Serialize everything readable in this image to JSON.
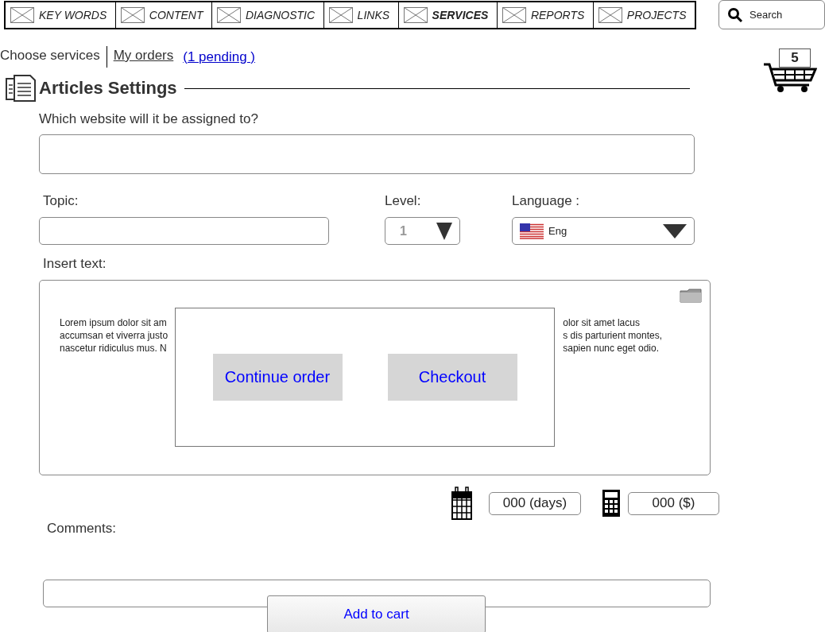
{
  "nav": {
    "tabs": [
      {
        "label": "KEY WORDS",
        "selected": false
      },
      {
        "label": "CONTENT",
        "selected": false
      },
      {
        "label": "DIAGNOSTIC",
        "selected": false
      },
      {
        "label": "LINKS",
        "selected": false
      },
      {
        "label": "SERVICES",
        "selected": true
      },
      {
        "label": "REPORTS",
        "selected": false
      },
      {
        "label": "PROJECTS",
        "selected": false
      }
    ],
    "search": {
      "placeholder": "Search"
    }
  },
  "subnav": {
    "items": [
      {
        "label": "Choose services",
        "selected": true
      },
      {
        "label": "My orders",
        "selected": false
      }
    ],
    "pending": "(1 pending )"
  },
  "cart": {
    "count": "5"
  },
  "section": {
    "title": "Articles Settings"
  },
  "form": {
    "website_label": "Which website will it be assigned to?",
    "topic_label": "Topic:",
    "level_label": "Level:",
    "level_value": "1",
    "language_label": "Language :",
    "language_value": "Eng",
    "text_label": "Insert text:",
    "text_left": [
      "Lorem ipsum dolor sit am",
      "accumsan et viverra justo",
      "nascetur ridiculus mus. N"
    ],
    "text_right": [
      "olor sit amet lacus",
      "s dis parturient montes,",
      "sapien nunc eget odio."
    ],
    "days": "000 (days)",
    "price": "000 ($)",
    "comments_label": "Comments:",
    "add_button": "Add to cart"
  },
  "dialog": {
    "buttons": [
      "Continue order",
      "Checkout"
    ]
  }
}
